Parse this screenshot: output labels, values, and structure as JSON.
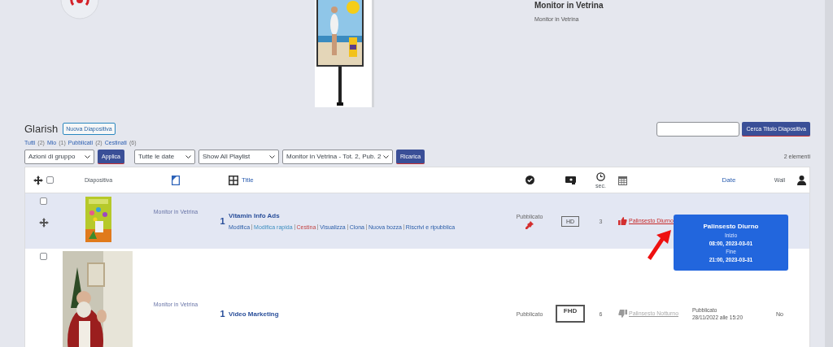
{
  "monitor": {
    "title": "Monitor in Vetrina",
    "subtitle": "Monitor in Vetrina"
  },
  "page": {
    "title": "Glarish",
    "new_button": "Nuova Diapositiva"
  },
  "filters": [
    {
      "label": "Tutti",
      "count": "(2)"
    },
    {
      "label": "Mio",
      "count": "(1)"
    },
    {
      "label": "Pubblicati",
      "count": "(2)"
    },
    {
      "label": "Cestinati",
      "count": "(6)"
    }
  ],
  "toolbar": {
    "bulk_select": "Azioni di gruppo",
    "apply": "Applica",
    "date_select": "Tutte le date",
    "playlist_select": "Show All Playlist",
    "monitor_select": "Monitor in Vetrina - Tot. 2, Pub. 2",
    "reload": "Ricarica"
  },
  "search": {
    "button": "Cerca Titolo Diapositiva"
  },
  "count": "2 elementi",
  "columns": {
    "select_all_checked": false,
    "slide": "Diapositiva",
    "title": "Title",
    "seconds": "sec.",
    "date": "Date",
    "wall": "Wall"
  },
  "rows": [
    {
      "highlighted": true,
      "checked": false,
      "monitor": "Monitor in Vetrina",
      "order": "1",
      "title": "Vitamin Info Ads",
      "actions": [
        {
          "label": "Modifica",
          "kind": "link"
        },
        {
          "label": "Modifica rapida",
          "kind": "quick"
        },
        {
          "label": "Cestina",
          "kind": "trash"
        },
        {
          "label": "Visualizza",
          "kind": "link"
        },
        {
          "label": "Clona",
          "kind": "link"
        },
        {
          "label": "Nuova bozza",
          "kind": "link"
        },
        {
          "label": "Riscrivi e ripubblica",
          "kind": "link"
        }
      ],
      "status": "Pubblicato",
      "pinned": true,
      "resolution": "HD",
      "emphasized": false,
      "seconds": "3",
      "schedule": {
        "label": "Palinsesto Diurno",
        "active": true
      }
    },
    {
      "highlighted": false,
      "checked": false,
      "monitor": "Monitor in Vetrina",
      "order": "1",
      "title": "Video Marketing",
      "actions": [],
      "status": "Pubblicato",
      "pinned": false,
      "resolution": "FHD",
      "emphasized": true,
      "seconds": "6",
      "schedule": {
        "label": "Palinsesto Notturno",
        "active": false
      },
      "date_status": "Pubblicato",
      "date": "28/11/2022 alle 15:20",
      "wall": "No"
    }
  ],
  "tooltip": {
    "title": "Palinsesto Diurno",
    "start_label": "Inizio",
    "start": "08:00, 2023-03-01",
    "end_label": "Fine",
    "end": "21:00, 2023-03-31"
  }
}
